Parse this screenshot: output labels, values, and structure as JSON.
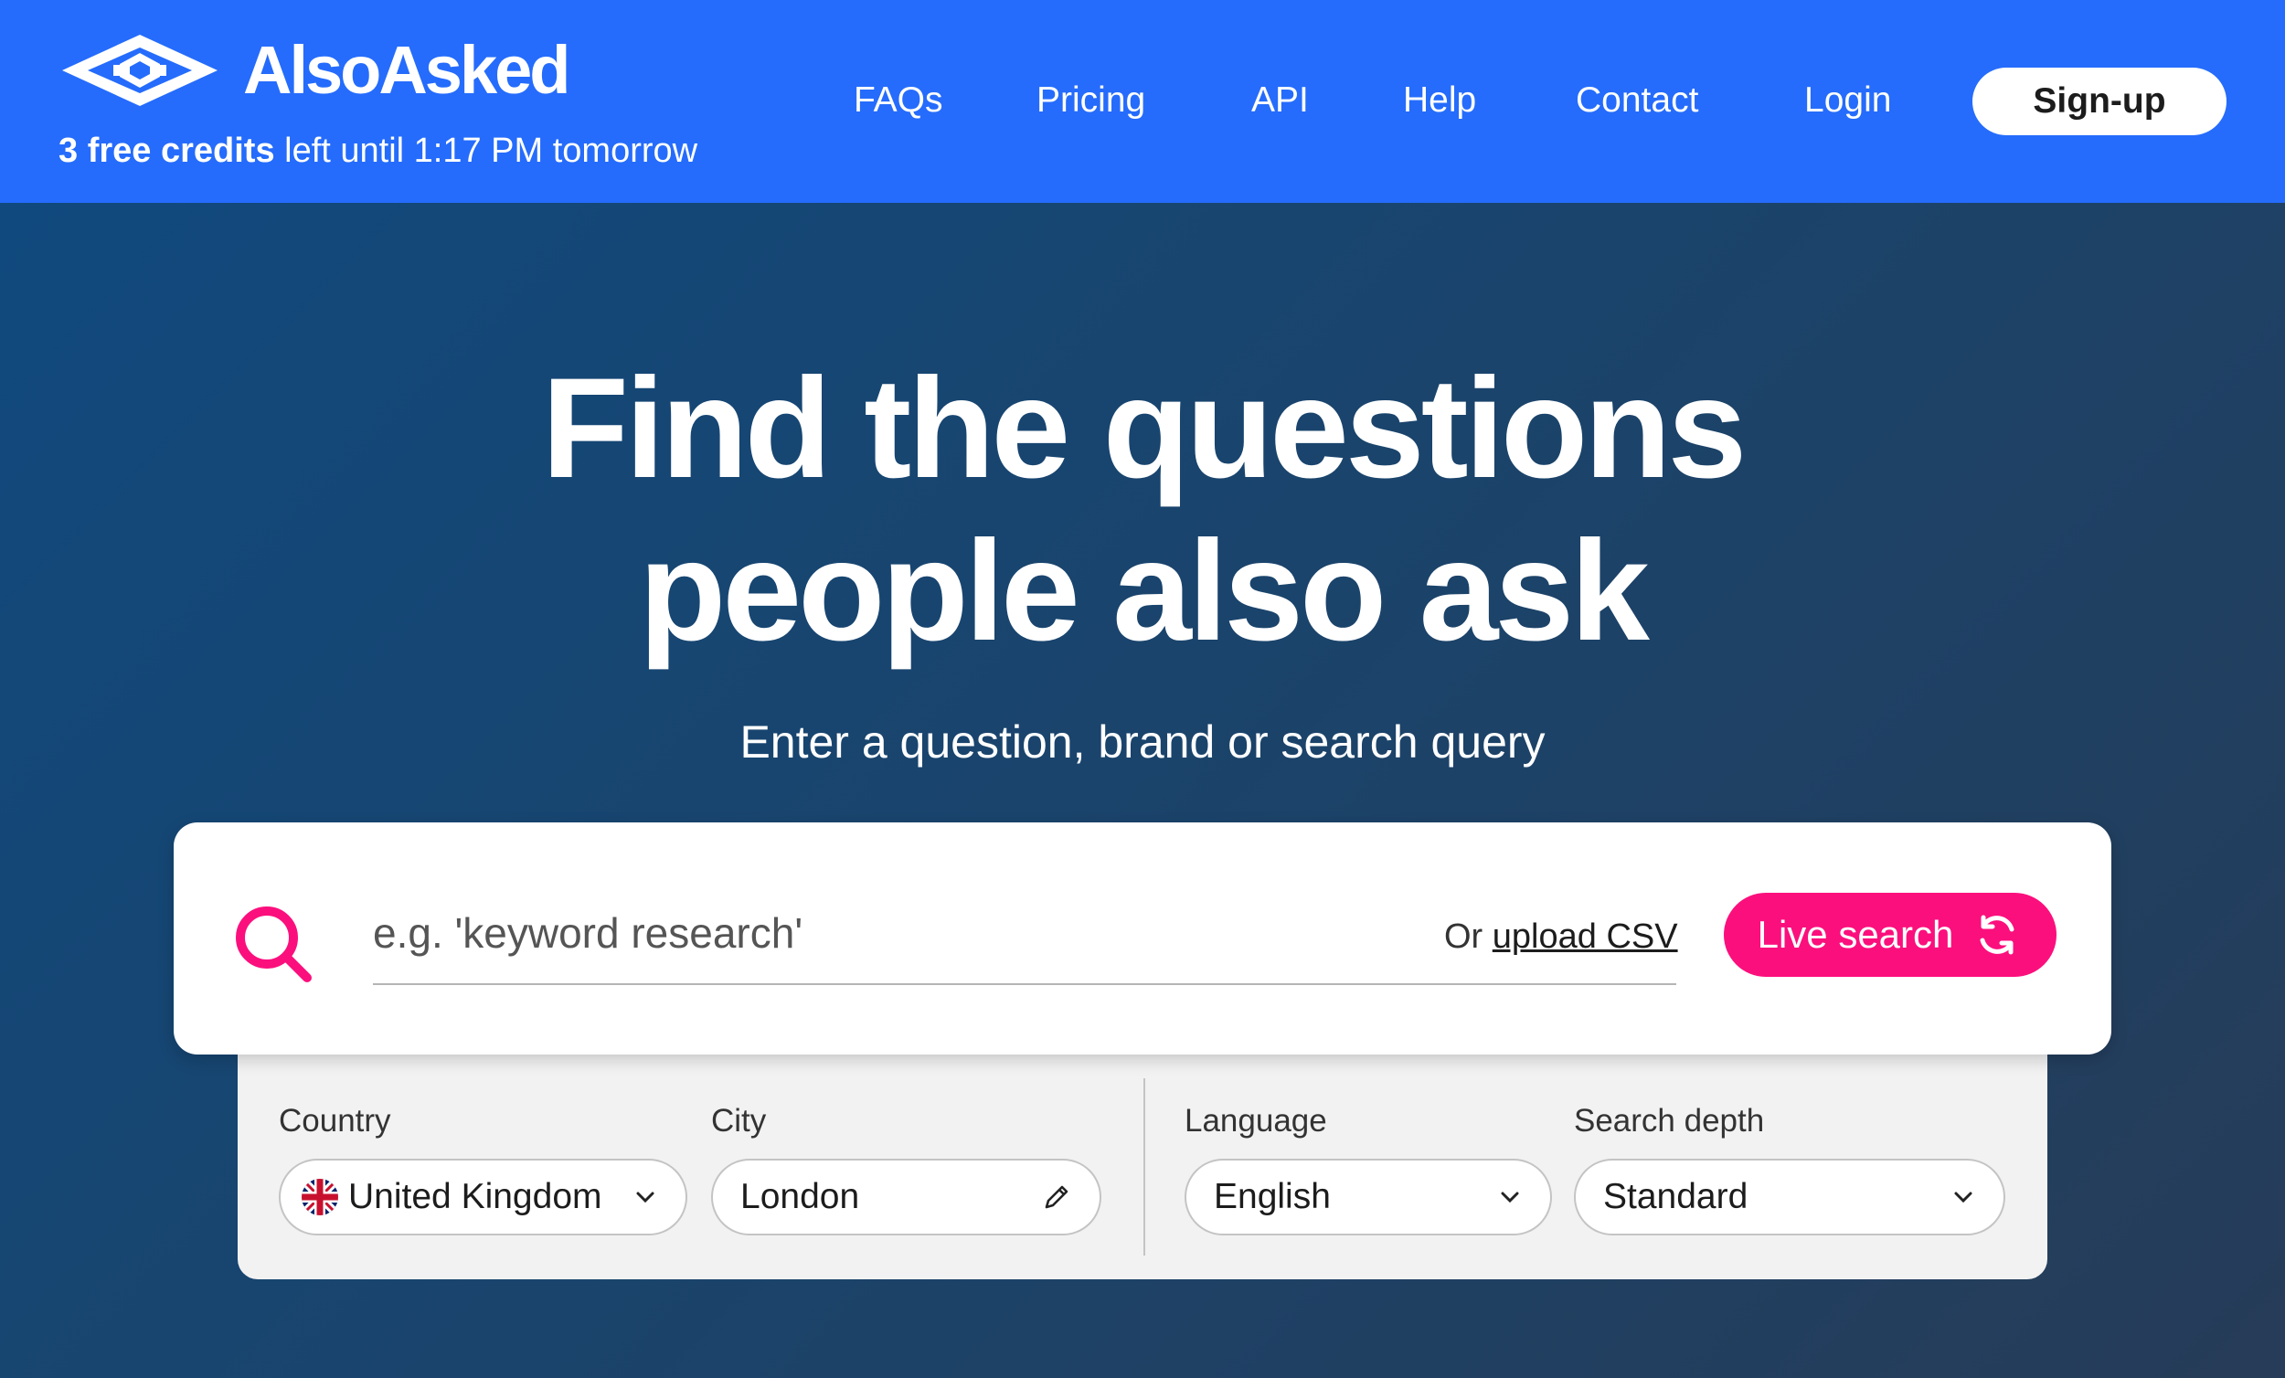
{
  "header": {
    "brand": "AlsoAsked",
    "credits_bold": "3 free credits",
    "credits_rest": " left until 1:17 PM tomorrow",
    "nav": [
      "FAQs",
      "Pricing",
      "API",
      "Help",
      "Contact",
      "Login"
    ],
    "signup_label": "Sign-up"
  },
  "hero": {
    "title_line1": "Find the questions",
    "title_line2": "people also ask",
    "subtitle": "Enter a question, brand or search query"
  },
  "search": {
    "placeholder": "e.g. 'keyword research'",
    "or_text": "Or ",
    "upload_label": "upload CSV",
    "live_label": "Live search"
  },
  "options": {
    "country_label": "Country",
    "country_value": "United Kingdom",
    "city_label": "City",
    "city_value": "London",
    "language_label": "Language",
    "language_value": "English",
    "depth_label": "Search depth",
    "depth_value": "Standard"
  },
  "colors": {
    "header_bg": "#256cfc",
    "accent_pink": "#fb0f7d",
    "hero_bg": "#1a446c"
  },
  "icons": [
    "logo-eye-icon",
    "search-icon",
    "refresh-icon",
    "uk-flag-icon",
    "chevron-down-icon",
    "pencil-icon"
  ]
}
